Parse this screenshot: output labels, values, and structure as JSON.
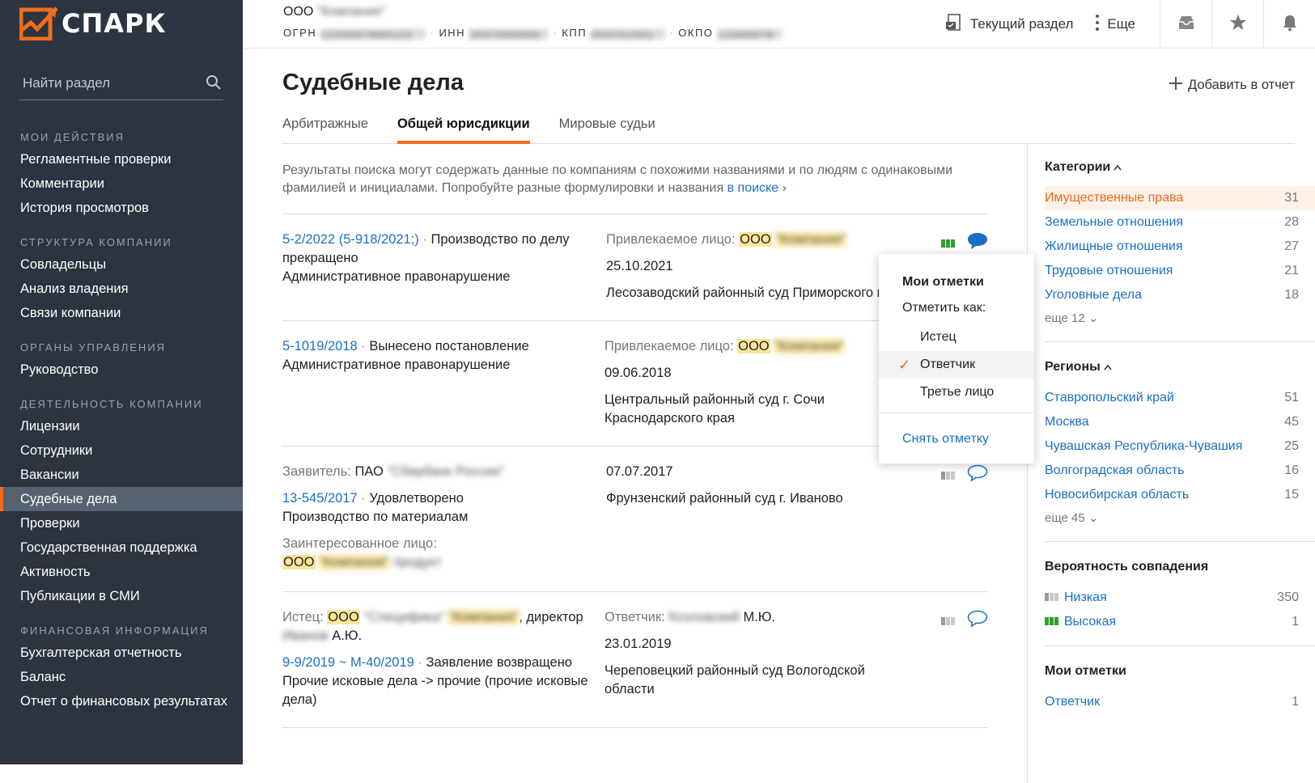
{
  "app": {
    "name": "СПАРК",
    "colors": {
      "sidebar": "#2b3440",
      "accent": "#f26b1d",
      "link": "#1a6fc5"
    }
  },
  "sidebar": {
    "search_placeholder": "Найти раздел",
    "groups": [
      {
        "title": "МОИ ДЕЙСТВИЯ",
        "items": [
          "Регламентные проверки",
          "Комментарии",
          "История просмотров"
        ]
      },
      {
        "title": "СТРУКТУРА КОМПАНИИ",
        "items": [
          "Совладельцы",
          "Анализ владения",
          "Связи компании"
        ]
      },
      {
        "title": "ОРГАНЫ УПРАВЛЕНИЯ",
        "items": [
          "Руководство"
        ]
      },
      {
        "title": "ДЕЯТЕЛЬНОСТЬ КОМПАНИИ",
        "items": [
          "Лицензии",
          "Сотрудники",
          "Вакансии",
          "Судебные дела",
          "Проверки",
          "Государственная поддержка",
          "Активность",
          "Публикации в СМИ"
        ]
      },
      {
        "title": "ФИНАНСОВАЯ ИНФОРМАЦИЯ",
        "items": [
          "Бухгалтерская отчетность",
          "Баланс",
          "Отчет о финансовых результатах"
        ]
      }
    ]
  },
  "header": {
    "company_prefix": "ООО",
    "company_name": "\"Компания\"",
    "id_labels": [
      "ОГРН",
      "ИНН",
      "КПП",
      "ОКПО"
    ],
    "id_values": [
      "1234567890123",
      "2537000000",
      "253701001",
      "12345678"
    ],
    "current_section": "Текущий раздел",
    "more": "Еще"
  },
  "page": {
    "title": "Судебные дела",
    "add_to_report": "Добавить в отчет",
    "tabs": [
      "Арбитражные",
      "Общей юрисдикции",
      "Мировые судьи"
    ],
    "notice_text": "Результаты поиска могут содержать данные по компаниям с похожими названиями и по людям с одинаковыми фамилией и инициалами. Попробуйте разные формулировки и названия",
    "notice_link": "в поиске"
  },
  "cases": [
    {
      "number": "5-2/2022 (5-918/2021;)",
      "status": "Производство по делу прекращено",
      "category": "Административное правонарушение",
      "party_label": "Привлекаемое лицо:",
      "party_prefix": "ООО",
      "party_name": "\"Компания\"",
      "date": "25.10.2021",
      "court": "Лесозаводский районный суд Приморского края"
    },
    {
      "number": "5-1019/2018",
      "status": "Вынесено постановление",
      "category": "Административное правонарушение",
      "party_label": "Привлекаемое лицо:",
      "party_prefix": "ООО",
      "party_name": "\"Компания\"",
      "date": "09.06.2018",
      "court": "Центральный районный суд г. Сочи Краснодарского края"
    },
    {
      "applicant_label": "Заявитель:",
      "applicant_prefix": "ПАО",
      "applicant_name": "\"Сбербанк России\"",
      "number": "13-545/2017",
      "status": "Удовлетворено",
      "category": "Производство по материалам",
      "interested_label": "Заинтересованное лицо:",
      "interested_prefix": "ООО",
      "interested_name": "\"Компания\"",
      "interested_extra": "продукт",
      "date": "07.07.2017",
      "court": "Фрунзенский районный суд г. Иваново"
    },
    {
      "plaintiff_label": "Истец:",
      "plaintiff_prefix": "ООО",
      "plaintiff_name": "\"Специфика\"",
      "plaintiff_name2": "\"Компания\"",
      "plaintiff_role": ", директор",
      "plaintiff_person": "Иванов",
      "plaintiff_initials": "А.Ю.",
      "defendant_label": "Ответчик:",
      "defendant_name": "Козловский",
      "defendant_initials": "М.Ю.",
      "number": "9-9/2019 ~ М-40/2019",
      "status": "Заявление возвращено",
      "category": "Прочие исковые дела -> прочие (прочие исковые дела)",
      "date": "23.01.2019",
      "court": "Череповецкий районный суд Вологодской области"
    }
  ],
  "filters": {
    "categories": {
      "title": "Категории",
      "items": [
        {
          "label": "Имущественные права",
          "count": "31"
        },
        {
          "label": "Земельные отношения",
          "count": "28"
        },
        {
          "label": "Жилищные отношения",
          "count": "27"
        },
        {
          "label": "Трудовые отношения",
          "count": "21"
        },
        {
          "label": "Уголовные дела",
          "count": "18"
        }
      ],
      "more": "еще 12"
    },
    "regions": {
      "title": "Регионы",
      "items": [
        {
          "label": "Ставропольский край",
          "count": "51"
        },
        {
          "label": "Москва",
          "count": "45"
        },
        {
          "label": "Чувашская Республика-Чувашия",
          "count": "25"
        },
        {
          "label": "Волгоградская область",
          "count": "16"
        },
        {
          "label": "Новосибирская область",
          "count": "15"
        }
      ],
      "more": "еще 45"
    },
    "match": {
      "title": "Вероятность совпадения",
      "items": [
        {
          "label": "Низкая",
          "count": "350"
        },
        {
          "label": "Высокая",
          "count": "1"
        }
      ]
    },
    "marks": {
      "title": "Мои отметки",
      "items": [
        {
          "label": "Ответчик",
          "count": "1"
        }
      ]
    }
  },
  "popup": {
    "title": "Мои отметки",
    "subtitle": "Отметить как:",
    "options": [
      "Истец",
      "Ответчик",
      "Третье лицо"
    ],
    "checked": "Ответчик",
    "clear": "Снять отметку"
  }
}
